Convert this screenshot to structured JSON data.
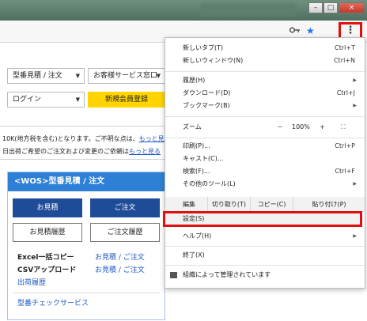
{
  "window": {
    "minimize_label": "–",
    "maximize_label": "□",
    "close_label": "×"
  },
  "toolbar": {
    "key_icon": "key-icon",
    "star_icon": "star-icon",
    "menu_icon": "⋮"
  },
  "page": {
    "model_select": "型番見積 / 注文",
    "support_select": "お客様サービス窓口",
    "login_select": "ログイン",
    "register_button": "新規会員登録",
    "notice1_text": "10K(地方税を含む)となります。ご不明な点は、",
    "notice1_link": "もっと見る",
    "notice2_text": "日出荷ご希望のご注文および変更のご依頼は",
    "notice2_link": "もっと見る",
    "wos": {
      "header": "<WOS>型番見積 / 注文",
      "quote_button": "お見積",
      "order_button": "ご注文",
      "quote_history_button": "お見積履歴",
      "order_history_button": "ご注文履歴",
      "excel_label": "Excel一括コピー",
      "excel_links": "お見積 / ご注文",
      "csv_label": "CSVアップロード",
      "csv_links": "お見積 / ご注文",
      "shipping_history": "出荷履歴",
      "model_check": "型番チェックサービス"
    }
  },
  "menu": {
    "new_tab": "新しいタブ(T)",
    "new_tab_shortcut": "Ctrl+T",
    "new_window": "新しいウィンドウ(N)",
    "new_window_shortcut": "Ctrl+N",
    "history": "履歴(H)",
    "downloads": "ダウンロード(D)",
    "downloads_shortcut": "Ctrl+J",
    "bookmarks": "ブックマーク(B)",
    "zoom_label": "ズーム",
    "zoom_minus": "－",
    "zoom_value": "100%",
    "zoom_plus": "+",
    "zoom_fullscreen": "⛶",
    "print": "印刷(P)...",
    "print_shortcut": "Ctrl+P",
    "cast": "キャスト(C)...",
    "find": "検索(F)...",
    "find_shortcut": "Ctrl+F",
    "more_tools": "その他のツール(L)",
    "edit_label": "編集",
    "cut": "切り取り(T)",
    "copy": "コピー(C)",
    "paste": "貼り付け(P)",
    "settings": "設定(S)",
    "help": "ヘルプ(H)",
    "exit": "終了(X)",
    "managed": "組織によって管理されています"
  }
}
